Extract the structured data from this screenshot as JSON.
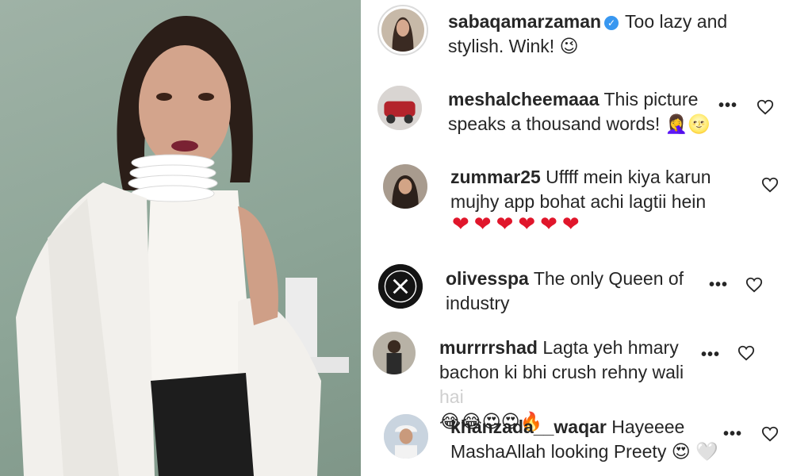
{
  "post": {
    "photo_alt": "",
    "photo": {
      "background": "#8fa698",
      "shirt": "#f4f2ee",
      "pants": "#1d1d1d"
    }
  },
  "comments": [
    {
      "username": "sabaqamarzaman",
      "verified": true,
      "text_line1": "Too lazy and",
      "text_line2": "stylish. Wink!",
      "emojis": "😉",
      "is_author": true
    },
    {
      "username": "meshalcheemaaa",
      "text_line1": "This picture",
      "text_line2": "speaks a thousand words!",
      "emojis": "🤦‍♀️🌝"
    },
    {
      "username": "zummar25",
      "text_line1": "Uffff mein kiya karun",
      "text_line2": "mujhy app bohat achi lagtii hein",
      "emojis": "❤❤❤❤❤❤"
    },
    {
      "username": "olivesspa",
      "text_line1": "The only Queen of",
      "text_line2": "industry"
    },
    {
      "username": "murrrrshad",
      "text_line1": "Lagta yeh hmary",
      "text_line2": "bachon ki bhi crush rehny wali",
      "text_faded": "hai",
      "emojis": "😂😂😍😍🔥"
    },
    {
      "username": "khanzada__waqar",
      "text_line1": "Hayeeee",
      "text_line2": "MashaAllah looking Preety",
      "emojis": "😍",
      "emoji_faded": "🤍"
    }
  ],
  "icons": {
    "more": "more-options-icon",
    "like": "heart-outline-icon",
    "verified": "verified-badge-icon"
  },
  "ui": {
    "more_symbol": "•••",
    "verified_symbol": "✓"
  },
  "colors": {
    "text": "#262626",
    "verified": "#3897f0",
    "heart": "#e0162b"
  }
}
